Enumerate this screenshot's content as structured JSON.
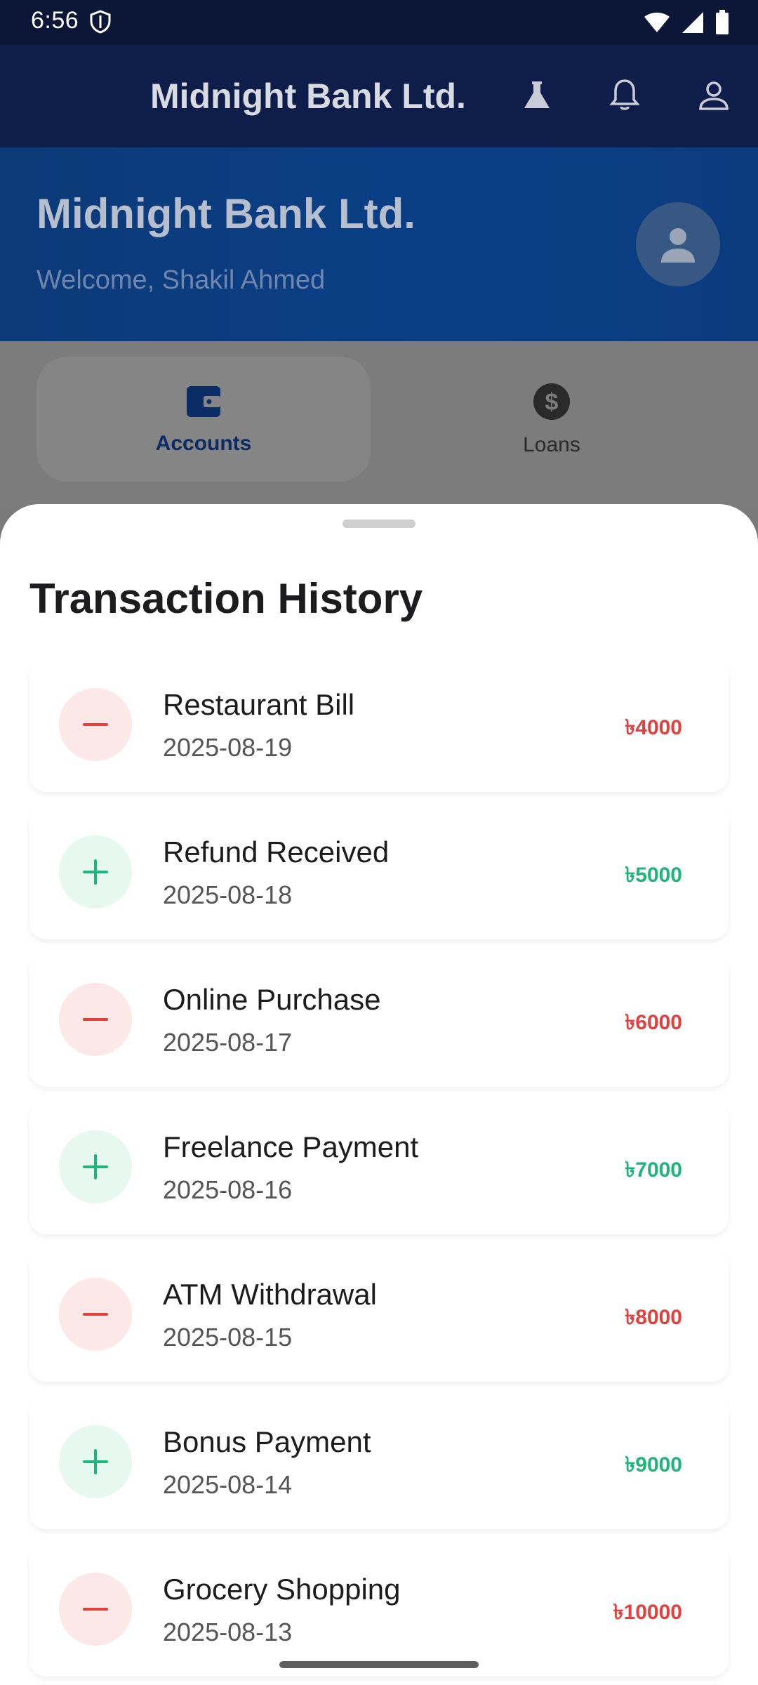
{
  "status_bar": {
    "time": "6:56",
    "icons": [
      "shield-icon",
      "wifi-icon",
      "signal-icon",
      "battery-icon"
    ]
  },
  "app_bar": {
    "title": "Midnight Bank Ltd.",
    "actions": [
      "flask-icon",
      "bell-icon",
      "person-icon"
    ]
  },
  "hero": {
    "bank_name": "Midnight Bank Ltd.",
    "welcome": "Welcome, Shakil Ahmed"
  },
  "tabs": [
    {
      "label": "Accounts",
      "icon": "wallet-icon",
      "active": true
    },
    {
      "label": "Loans",
      "icon": "dollar-icon",
      "active": false
    }
  ],
  "sheet": {
    "title": "Transaction History",
    "transactions": [
      {
        "name": "Restaurant Bill",
        "date": "2025-08-19",
        "amount": "৳4000",
        "type": "debit"
      },
      {
        "name": "Refund Received",
        "date": "2025-08-18",
        "amount": "৳5000",
        "type": "credit"
      },
      {
        "name": "Online Purchase",
        "date": "2025-08-17",
        "amount": "৳6000",
        "type": "debit"
      },
      {
        "name": "Freelance Payment",
        "date": "2025-08-16",
        "amount": "৳7000",
        "type": "credit"
      },
      {
        "name": "ATM Withdrawal",
        "date": "2025-08-15",
        "amount": "৳8000",
        "type": "debit"
      },
      {
        "name": "Bonus Payment",
        "date": "2025-08-14",
        "amount": "৳9000",
        "type": "credit"
      },
      {
        "name": "Grocery Shopping",
        "date": "2025-08-13",
        "amount": "৳10000",
        "type": "debit"
      }
    ]
  },
  "colors": {
    "debit": "#e0413f",
    "credit": "#1fb57a",
    "app_bar_bg": "#0f1d4a",
    "hero_bg": "#0a3f86"
  }
}
